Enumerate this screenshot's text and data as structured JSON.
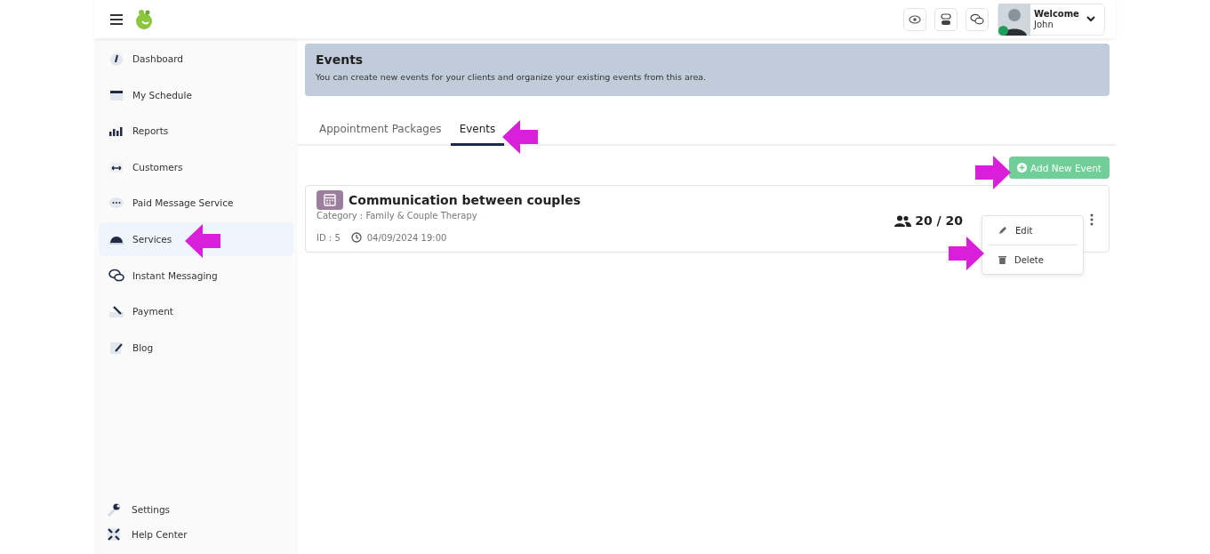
{
  "header": {
    "welcome": "Welcome",
    "user": "John",
    "online": true
  },
  "sidebar": {
    "items": [
      {
        "label": "Dashboard",
        "selected": false
      },
      {
        "label": "My Schedule",
        "selected": false
      },
      {
        "label": "Reports",
        "selected": false
      },
      {
        "label": "Customers",
        "selected": false
      },
      {
        "label": "Paid Message Service",
        "selected": false
      },
      {
        "label": "Services",
        "selected": true
      },
      {
        "label": "Instant Messaging",
        "selected": false
      },
      {
        "label": "Payment",
        "selected": false
      },
      {
        "label": "Blog",
        "selected": false
      }
    ],
    "footer_items": [
      {
        "label": "Settings"
      },
      {
        "label": "Help Center"
      }
    ]
  },
  "banner": {
    "title": "Events",
    "text": "You can create new events for your clients and organize your existing events from this area."
  },
  "tabs": [
    {
      "label": "Appointment Packages",
      "selected": false
    },
    {
      "label": "Events",
      "selected": true
    }
  ],
  "add_button": "Add New Event",
  "events": [
    {
      "title": "Communication between couples",
      "category": "Category : Family & Couple Therapy",
      "id": "ID : 5",
      "date": "04/09/2024 19:00",
      "capacity": "20 / 20"
    }
  ],
  "menu": [
    {
      "label": "Edit",
      "kind": "edit"
    },
    {
      "label": "Delete",
      "kind": "delete"
    }
  ]
}
